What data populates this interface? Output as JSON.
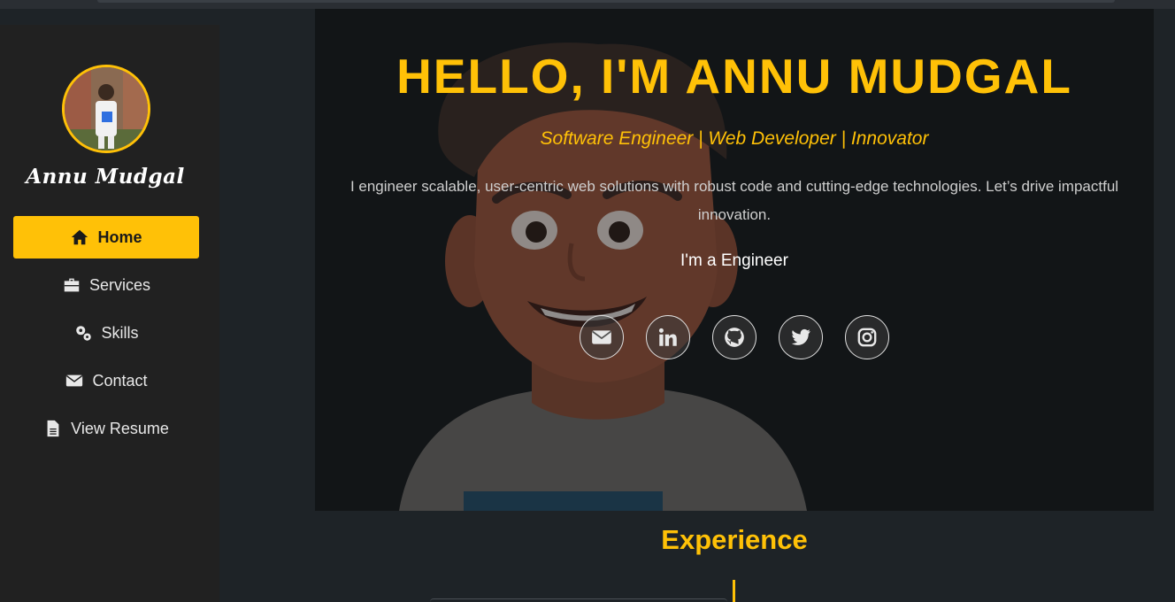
{
  "sidebar": {
    "brand_name": "Annu Mudgal",
    "nav": [
      {
        "label": "Home",
        "icon": "home-icon",
        "active": true
      },
      {
        "label": "Services",
        "icon": "briefcase-icon",
        "active": false
      },
      {
        "label": "Skills",
        "icon": "gears-icon",
        "active": false
      },
      {
        "label": "Contact",
        "icon": "envelope-icon",
        "active": false
      },
      {
        "label": "View Resume",
        "icon": "file-icon",
        "active": false
      }
    ]
  },
  "hero": {
    "title": "HELLO, I'M ANNU MUDGAL",
    "subtitle": "Software Engineer | Web Developer | Innovator",
    "description": "I engineer scalable, user-centric web solutions with robust code and cutting-edge technologies. Let’s drive impactful innovation.",
    "typed_text": "I'm a Engineer",
    "socials": [
      {
        "name": "email",
        "icon": "envelope-icon"
      },
      {
        "name": "linkedin",
        "icon": "linkedin-icon"
      },
      {
        "name": "github",
        "icon": "github-icon"
      },
      {
        "name": "twitter",
        "icon": "twitter-icon"
      },
      {
        "name": "instagram",
        "icon": "instagram-icon"
      }
    ]
  },
  "experience": {
    "title": "Experience"
  },
  "colors": {
    "accent": "#ffc107",
    "background": "#1e2327",
    "sidebar": "#212121",
    "hero_bg": "#121517"
  }
}
